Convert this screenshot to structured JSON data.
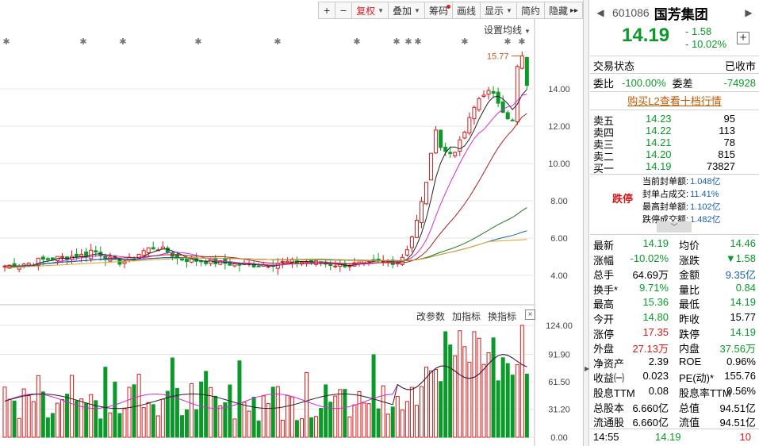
{
  "toolbar": {
    "plus": "+",
    "minus": "−",
    "buttons": [
      "复权",
      "叠加",
      "筹码",
      "画线",
      "显示",
      "简约",
      "隐藏"
    ],
    "more": "▸▸"
  },
  "ma_setting_label": "设置均线",
  "indicator_menu": [
    "改参数",
    "加指标",
    "换指标"
  ],
  "close_symbol": "×",
  "stock": {
    "code": "601086",
    "name": "国芳集团",
    "price": "14.19",
    "change": "- 1.58",
    "change_pct": "- 10.02%",
    "add_symbol": "+"
  },
  "trade_status": {
    "label": "交易状态",
    "value": "已收市"
  },
  "order_ratio": {
    "label": "委比",
    "value": "-100.00%",
    "diff_label": "委差",
    "diff_value": "-74928"
  },
  "l2_link": "购买L2查看十档行情",
  "order_book": [
    {
      "label": "卖五",
      "price": "14.23",
      "vol": "95"
    },
    {
      "label": "卖四",
      "price": "14.22",
      "vol": "113"
    },
    {
      "label": "卖三",
      "price": "14.21",
      "vol": "78"
    },
    {
      "label": "卖二",
      "price": "14.20",
      "vol": "815"
    },
    {
      "label": "买一",
      "price": "14.19",
      "vol": "73827"
    }
  ],
  "limit_down_tag": "跌停",
  "seal": [
    {
      "label": "当前封单额:",
      "value": "1.048亿"
    },
    {
      "label": "封单占成交:",
      "value": "11.41%"
    },
    {
      "label": "最高封单额:",
      "value": "1.102亿"
    },
    {
      "label": "跌停成交额:",
      "value": "1.482亿"
    }
  ],
  "quote": [
    {
      "k1": "最新",
      "v1": "14.19",
      "k2": "均价",
      "v2": "14.46"
    },
    {
      "k1": "涨幅",
      "v1": "-10.02%",
      "k2": "涨跌",
      "v2": "▼1.58"
    },
    {
      "k1": "总手",
      "v1": "64.69万",
      "k2": "金额",
      "v2": "9.35亿"
    },
    {
      "k1": "换手*",
      "v1": "9.71%",
      "k2": "量比",
      "v2": "0.84"
    },
    {
      "k1": "最高",
      "v1": "15.36",
      "k2": "最低",
      "v2": "14.19"
    },
    {
      "k1": "今开",
      "v1": "14.80",
      "k2": "昨收",
      "v2": "15.77"
    },
    {
      "k1": "涨停",
      "v1": "17.35",
      "k2": "跌停",
      "v2": "14.19"
    },
    {
      "k1": "外盘",
      "v1": "27.13万",
      "k2": "内盘",
      "v2": "37.56万"
    },
    {
      "k1": "净资产",
      "v1": "2.39",
      "k2": "ROE",
      "v2": "0.96%"
    },
    {
      "k1": "收益㈠",
      "v1": "0.023",
      "k2": "PE(动)*",
      "v2": "155.76"
    },
    {
      "k1": "股息TTM",
      "v1": "0.08",
      "k2": "股息率TTM",
      "v2": "0.56%"
    },
    {
      "k1": "总股本",
      "v1": "6.660亿",
      "k2": "总值",
      "v2": "94.51亿"
    },
    {
      "k1": "流通股",
      "v1": "6.660亿",
      "k2": "流值",
      "v2": "94.51亿"
    }
  ],
  "last_tick": {
    "time": "14:55",
    "price": "14.19",
    "vol": "10"
  },
  "colors": {
    "up": "#d41a1a",
    "down": "#0a9a2a",
    "blue": "#1a5fb4",
    "link": "#c05a00"
  },
  "chart_data": [
    {
      "type": "candlestick",
      "title": "",
      "y_ticks": [
        "14.00",
        "12.00",
        "10.00",
        "8.00",
        "6.00",
        "4.00"
      ],
      "y_tick_values": [
        14,
        12,
        10,
        8,
        6,
        4
      ],
      "ylim": [
        3.2,
        16.3
      ],
      "annotation": "15.77",
      "annotation_value": 15.77,
      "grid": true,
      "moving_averages": [
        {
          "color": "#222222"
        },
        {
          "color": "#d42bd4"
        },
        {
          "color": "#b02020"
        },
        {
          "color": "#1a7a1a"
        },
        {
          "color": "#1a5fb4"
        },
        {
          "color": "#e0a020"
        }
      ]
    },
    {
      "type": "bar",
      "title": "",
      "y_ticks": [
        "124.00",
        "91.90",
        "61.50",
        "31.20",
        "0.00"
      ],
      "y_tick_values": [
        124,
        91.9,
        61.5,
        31.2,
        0
      ],
      "ylim": [
        0,
        124
      ]
    }
  ]
}
